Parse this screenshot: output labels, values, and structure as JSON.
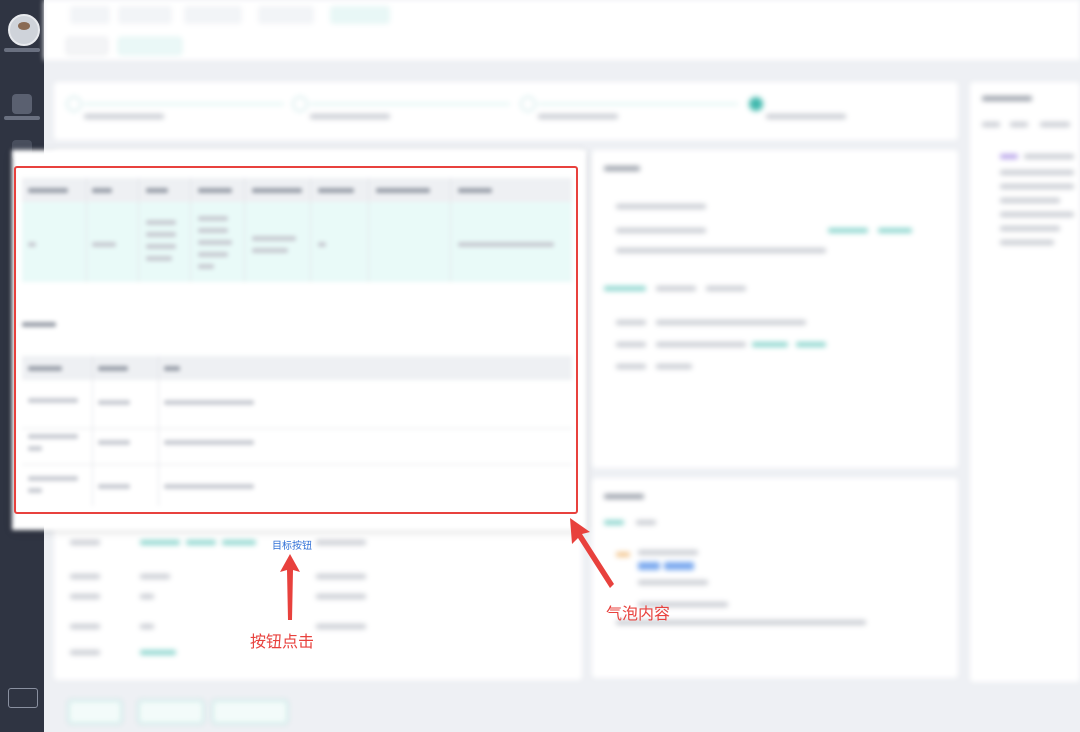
{
  "annotations": {
    "target_button_label": "目标按钮",
    "button_click_label": "按钮点击",
    "bubble_content_label": "气泡内容",
    "highlight_color": "#e8413d",
    "target_color": "#2f6fd6"
  },
  "icons": {
    "avatar": "user-avatar",
    "nav": [
      "nav-icon"
    ]
  }
}
